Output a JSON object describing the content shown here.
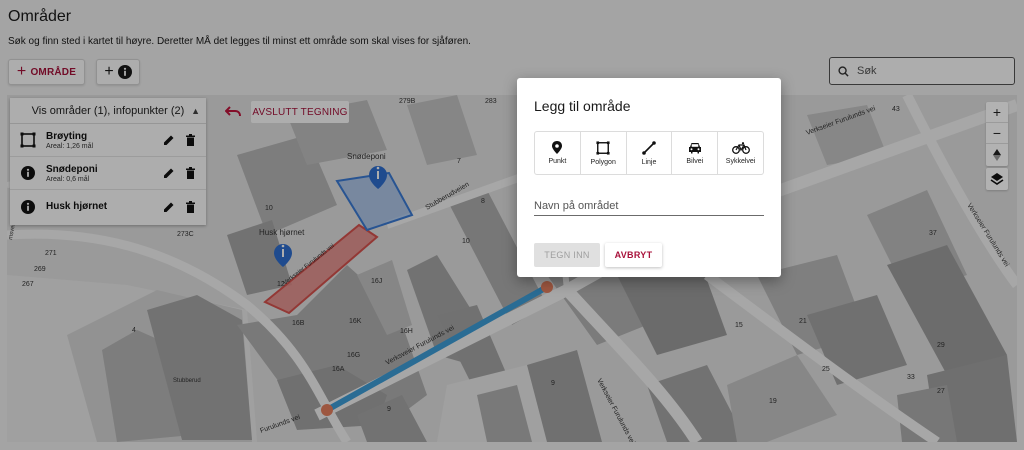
{
  "page": {
    "title": "Områder",
    "subtitle": "Søk og finn sted i kartet til høyre. Deretter MÅ det legges til minst ett område som skal vises for sjåføren."
  },
  "toolbar": {
    "add_area_label": "OMRÅDE",
    "add_info_label": "+"
  },
  "search": {
    "placeholder": "Søk"
  },
  "layers": {
    "header": "Vis områder (1), infopunkter (2)",
    "items": [
      {
        "name": "Brøyting",
        "meta": "Areal: 1,26 mål",
        "icon": "polygon-icon"
      },
      {
        "name": "Snødeponi",
        "meta": "Areal: 0,6 mål",
        "icon": "info-icon"
      },
      {
        "name": "Husk hjørnet",
        "meta": "",
        "icon": "info-icon"
      }
    ]
  },
  "drawing": {
    "end_label": "AVSLUTT TEGNING"
  },
  "dialog": {
    "title": "Legg til område",
    "types": [
      {
        "label": "Punkt",
        "icon": "point-icon"
      },
      {
        "label": "Polygon",
        "icon": "polygon-icon"
      },
      {
        "label": "Linje",
        "icon": "line-icon"
      },
      {
        "label": "Bilvei",
        "icon": "car-icon"
      },
      {
        "label": "Sykkelvei",
        "icon": "bicycle-icon"
      }
    ],
    "name_placeholder": "Navn på området",
    "draw_label": "TEGN INN",
    "cancel_label": "AVBRYT"
  },
  "map": {
    "labels": {
      "snodeponi": "Snødeponi",
      "husk": "Husk hjørnet",
      "road_label": "Verksveier Furulunds vei",
      "road_label_2": "Verkseier Furulunds vei",
      "stubberud": "Stubberudveien",
      "stubberud_bldg": "Stubberud",
      "polygon_label": "Verkseier Furulunds vei"
    },
    "numbers": [
      "279B",
      "283",
      "10",
      "273C",
      "271",
      "269",
      "267",
      "7",
      "8",
      "10",
      "12",
      "16J",
      "16B",
      "16K",
      "16H",
      "16G",
      "16A",
      "9",
      "15",
      "21",
      "25",
      "29",
      "33",
      "37",
      "43",
      "27",
      "4"
    ]
  },
  "colors": {
    "accent": "#a8123b",
    "polygon_red": "#d9534f",
    "polygon_blue": "#3b7dd8",
    "route_blue": "#3f9fdb"
  }
}
